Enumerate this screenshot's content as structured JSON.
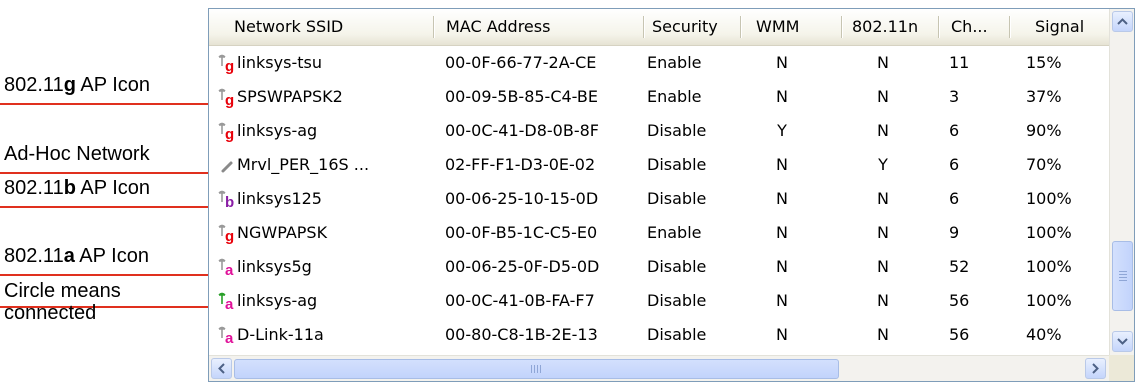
{
  "annotations": [
    {
      "before": "802.11",
      "bold": "g",
      "after": " AP Icon"
    },
    {
      "text": "Ad-Hoc Network"
    },
    {
      "before": "802.11",
      "bold": "b",
      "after": " AP Icon"
    },
    {
      "before": "802.11",
      "bold": "a",
      "after": " AP Icon"
    },
    {
      "line1": "Circle means",
      "line2": "connected"
    }
  ],
  "columns": [
    "Network SSID",
    "MAC Address",
    "Security",
    "WMM",
    "802.11n",
    "Ch...",
    "Signal"
  ],
  "rows": [
    {
      "icon": "ap-g-icon",
      "letter": "g",
      "ssid": "linksys-tsu",
      "mac": "00-0F-66-77-2A-CE",
      "security": "Enable",
      "wmm": "N",
      "n": "N",
      "ch": "11",
      "signal": "15%"
    },
    {
      "icon": "ap-g-icon",
      "letter": "g",
      "ssid": "SPSWPAPSK2",
      "mac": "00-09-5B-85-C4-BE",
      "security": "Enable",
      "wmm": "N",
      "n": "N",
      "ch": "3",
      "signal": "37%"
    },
    {
      "icon": "ap-g-icon",
      "letter": "g",
      "ssid": "linksys-ag",
      "mac": "00-0C-41-D8-0B-8F",
      "security": "Disable",
      "wmm": "Y",
      "n": "N",
      "ch": "6",
      "signal": "90%"
    },
    {
      "icon": "adhoc-icon",
      "letter": "",
      "ssid": "Mrvl_PER_16S ...",
      "mac": "02-FF-F1-D3-0E-02",
      "security": "Disable",
      "wmm": "N",
      "n": "Y",
      "ch": "6",
      "signal": "70%"
    },
    {
      "icon": "ap-b-icon",
      "letter": "b",
      "ssid": "linksys125",
      "mac": "00-06-25-10-15-0D",
      "security": "Disable",
      "wmm": "N",
      "n": "N",
      "ch": "6",
      "signal": "100%"
    },
    {
      "icon": "ap-g-icon",
      "letter": "g",
      "ssid": "NGWPAPSK",
      "mac": "00-0F-B5-1C-C5-E0",
      "security": "Enable",
      "wmm": "N",
      "n": "N",
      "ch": "9",
      "signal": "100%"
    },
    {
      "icon": "ap-a-icon",
      "letter": "a",
      "ssid": "linksys5g",
      "mac": "00-06-25-0F-D5-0D",
      "security": "Disable",
      "wmm": "N",
      "n": "N",
      "ch": "52",
      "signal": "100%"
    },
    {
      "icon": "ap-a-connected-icon",
      "letter": "a",
      "ssid": "linksys-ag",
      "mac": "00-0C-41-0B-FA-F7",
      "security": "Disable",
      "wmm": "N",
      "n": "N",
      "ch": "56",
      "signal": "100%"
    },
    {
      "icon": "ap-a-icon",
      "letter": "a",
      "ssid": "D-Link-11a",
      "mac": "00-80-C8-1B-2E-13",
      "security": "Disable",
      "wmm": "N",
      "n": "N",
      "ch": "56",
      "signal": "40%"
    }
  ],
  "colors": {
    "g": "#e8000a",
    "b": "#8a1ea6",
    "a": "#e0129a",
    "connected": "#2aa02a",
    "annotation_line": "#e0301e"
  },
  "scrollbar_icons": [
    "scroll-up-icon",
    "scroll-down-icon",
    "scroll-left-icon",
    "scroll-right-icon"
  ]
}
